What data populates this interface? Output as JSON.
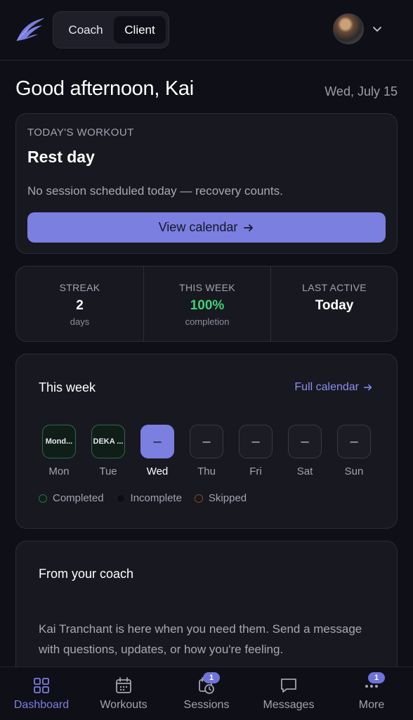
{
  "header": {
    "logo_icon": "wing-logo-icon",
    "mode_toggle": {
      "coach_label": "Coach",
      "client_label": "Client",
      "selected": "Client"
    },
    "avatar_icon": "user-avatar",
    "menu_icon": "chevron-down-icon"
  },
  "greeting": {
    "text": "Good afternoon, Kai",
    "date": "Wed, July 15"
  },
  "todays_workout": {
    "eyebrow": "TODAY'S WORKOUT",
    "title": "Rest day",
    "description": "No session scheduled today — recovery counts.",
    "button_label": "View calendar",
    "button_icon": "arrow-right-icon"
  },
  "stats": [
    {
      "label": "STREAK",
      "value": "2",
      "sub": "days",
      "color": "#ffffff"
    },
    {
      "label": "THIS WEEK",
      "value": "100%",
      "sub": "completion",
      "color": "#3fd17a"
    },
    {
      "label": "LAST ACTIVE",
      "value": "Today",
      "sub": "",
      "color": "#ffffff"
    }
  ],
  "week": {
    "title": "This week",
    "full_calendar_label": "Full calendar",
    "days": [
      {
        "label": "Mon",
        "content": "Mond...",
        "status": "completed"
      },
      {
        "label": "Tue",
        "content": "DEKA ...",
        "status": "completed"
      },
      {
        "label": "Wed",
        "content": "–",
        "status": "today"
      },
      {
        "label": "Thu",
        "content": "–",
        "status": "none"
      },
      {
        "label": "Fri",
        "content": "–",
        "status": "none"
      },
      {
        "label": "Sat",
        "content": "–",
        "status": "none"
      },
      {
        "label": "Sun",
        "content": "–",
        "status": "none"
      }
    ],
    "legend": [
      "Completed",
      "Incomplete",
      "Skipped"
    ]
  },
  "coach": {
    "title": "From your coach",
    "message": "Kai Tranchant is here when you need them. Send a message with questions, updates, or how you're feeling."
  },
  "nav": [
    {
      "label": "Dashboard",
      "icon": "grid-icon",
      "badge": "",
      "active": true
    },
    {
      "label": "Workouts",
      "icon": "calendar-icon",
      "badge": "",
      "active": false
    },
    {
      "label": "Sessions",
      "icon": "calendar-clock-icon",
      "badge": "1",
      "active": false
    },
    {
      "label": "Messages",
      "icon": "chat-bubble-icon",
      "badge": "",
      "active": false
    },
    {
      "label": "More",
      "icon": "more-dots-icon",
      "badge": "1",
      "active": false
    }
  ],
  "colors": {
    "accent": "#7b7fe0",
    "background": "#0f0f17",
    "card": "#181820",
    "success": "#3fd17a"
  }
}
